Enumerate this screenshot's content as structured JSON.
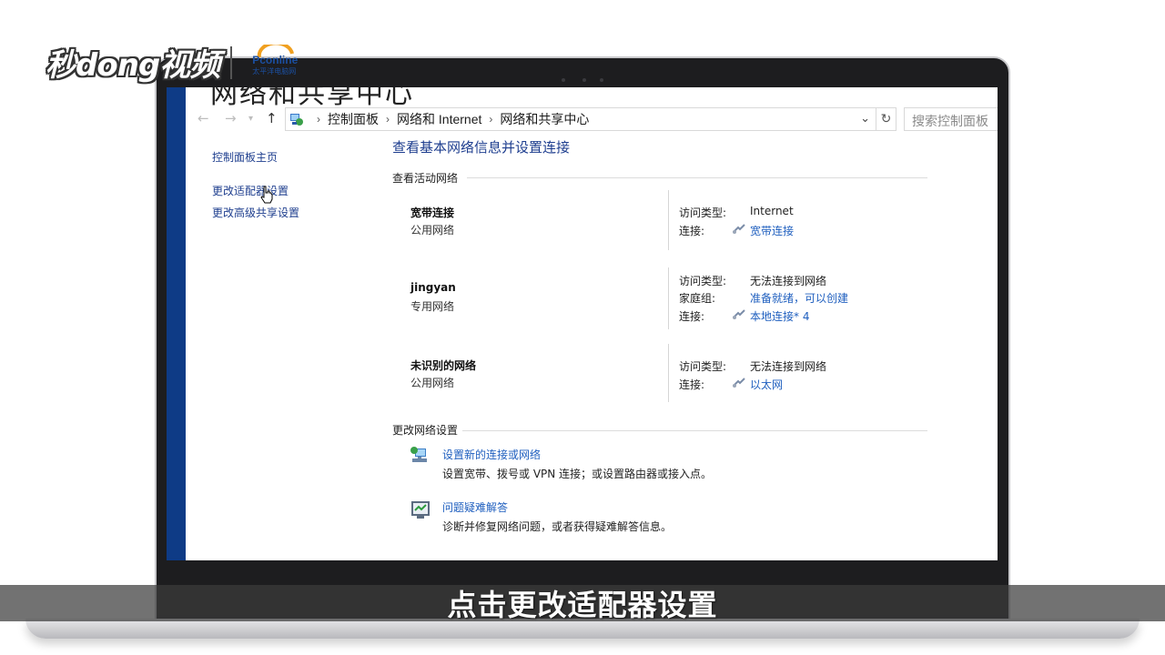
{
  "watermark": {
    "brand": "秒dong视频",
    "partner": "Pconline",
    "partner_sub": "太平洋电脑网"
  },
  "window": {
    "title": "网络和共享中心"
  },
  "address_bar": {
    "breadcrumbs": [
      "控制面板",
      "网络和 Internet",
      "网络和共享中心"
    ],
    "search_placeholder": "搜索控制面板"
  },
  "sidebar": {
    "items": [
      {
        "label": "控制面板主页"
      },
      {
        "label": "更改适配器设置"
      },
      {
        "label": "更改高级共享设置"
      }
    ]
  },
  "main": {
    "heading": "查看基本网络信息并设置连接",
    "active_networks_label": "查看活动网络",
    "networks": [
      {
        "name": "宽带连接",
        "type": "公用网络",
        "access_type_label": "访问类型:",
        "access_type": "Internet",
        "connection_label": "连接:",
        "connection": "宽带连接"
      },
      {
        "name": "jingyan",
        "type": "专用网络",
        "access_type_label": "访问类型:",
        "access_type": "无法连接到网络",
        "homegroup_label": "家庭组:",
        "homegroup": "准备就绪，可以创建",
        "connection_label": "连接:",
        "connection": "本地连接* 4"
      },
      {
        "name": "未识别的网络",
        "type": "公用网络",
        "access_type_label": "访问类型:",
        "access_type": "无法连接到网络",
        "connection_label": "连接:",
        "connection": "以太网"
      }
    ],
    "change_settings_label": "更改网络设置",
    "tasks": [
      {
        "title": "设置新的连接或网络",
        "desc": "设置宽带、拨号或 VPN 连接；或设置路由器或接入点。"
      },
      {
        "title": "问题疑难解答",
        "desc": "诊断并修复网络问题，或者获得疑难解答信息。"
      }
    ]
  },
  "subtitle": "点击更改适配器设置",
  "colors": {
    "link": "#1f5fbf",
    "heading": "#1e3e8f",
    "accent_strip": "#0e3b86"
  }
}
